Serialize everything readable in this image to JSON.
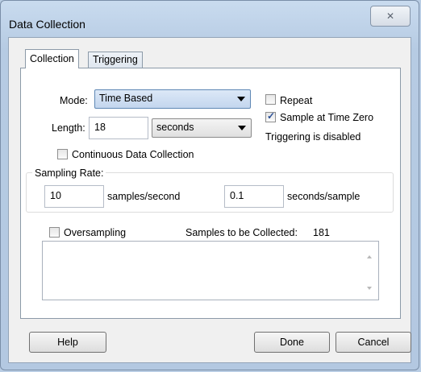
{
  "window": {
    "title": "Data Collection",
    "close_symbol": "✕"
  },
  "tabs": [
    {
      "label": "Collection",
      "active": true
    },
    {
      "label": "Triggering",
      "active": false
    }
  ],
  "mode": {
    "label": "Mode:",
    "value": "Time Based"
  },
  "length": {
    "label": "Length:",
    "value": "18",
    "units": "seconds"
  },
  "repeat": {
    "label": "Repeat",
    "checked": false
  },
  "sample_at_time_zero": {
    "label": "Sample at Time Zero",
    "checked": true
  },
  "triggering_status": "Triggering is disabled",
  "continuous": {
    "label": "Continuous Data Collection",
    "checked": false
  },
  "sampling_rate": {
    "label": "Sampling Rate:",
    "rate_value": "10",
    "rate_units": "samples/second",
    "interval_value": "0.1",
    "interval_units": "seconds/sample"
  },
  "oversampling": {
    "label": "Oversampling",
    "checked": false
  },
  "samples_collected": {
    "label": "Samples to be Collected:",
    "value": "181"
  },
  "buttons": {
    "help": "Help",
    "done": "Done",
    "cancel": "Cancel"
  },
  "icons": {
    "check": "checkmark-icon",
    "close": "close-icon",
    "dropdown": "chevron-down-icon"
  }
}
